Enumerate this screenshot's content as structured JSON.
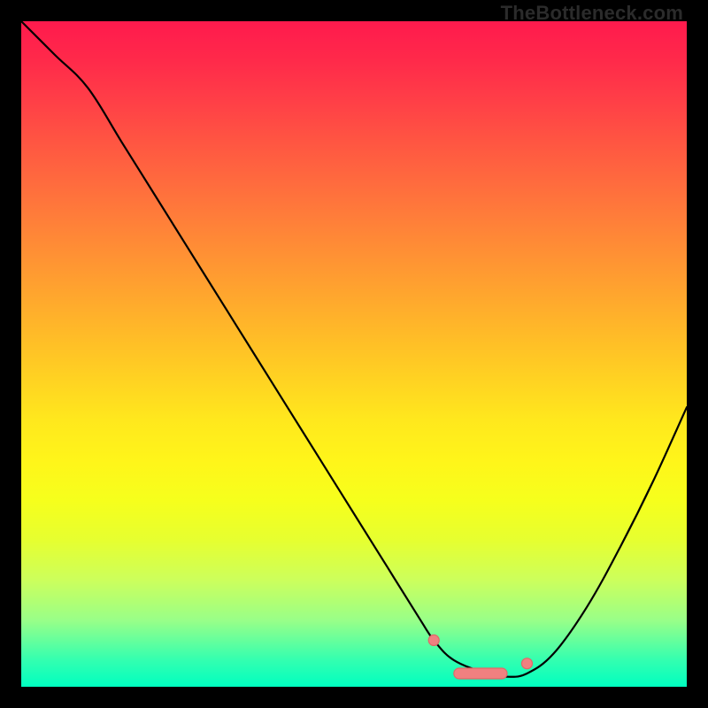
{
  "watermark": "TheBottleneck.com",
  "chart_data": {
    "type": "line",
    "title": "",
    "xlabel": "",
    "ylabel": "",
    "xlim": [
      0,
      100
    ],
    "ylim": [
      0,
      100
    ],
    "grid": false,
    "legend": false,
    "series": [
      {
        "name": "curve",
        "x": [
          0,
          5,
          10,
          15,
          20,
          25,
          30,
          35,
          40,
          45,
          50,
          55,
          60,
          62,
          65,
          70,
          73,
          76,
          80,
          85,
          90,
          95,
          100
        ],
        "y": [
          100,
          95,
          90,
          82,
          74,
          66,
          58,
          50,
          42,
          34,
          26,
          18,
          10,
          7,
          4,
          2,
          1.5,
          2,
          5,
          12,
          21,
          31,
          42
        ]
      }
    ],
    "markers": [
      {
        "shape": "dot",
        "x": 62,
        "y": 7
      },
      {
        "shape": "pill",
        "x0": 65,
        "x1": 73,
        "y": 2
      },
      {
        "shape": "dot",
        "x": 76,
        "y": 3.5
      }
    ],
    "gradient_stops": [
      {
        "pos": 0,
        "color": "#ff1a4d"
      },
      {
        "pos": 50,
        "color": "#ffd322"
      },
      {
        "pos": 80,
        "color": "#e6ff30"
      },
      {
        "pos": 100,
        "color": "#00ffc0"
      }
    ]
  }
}
